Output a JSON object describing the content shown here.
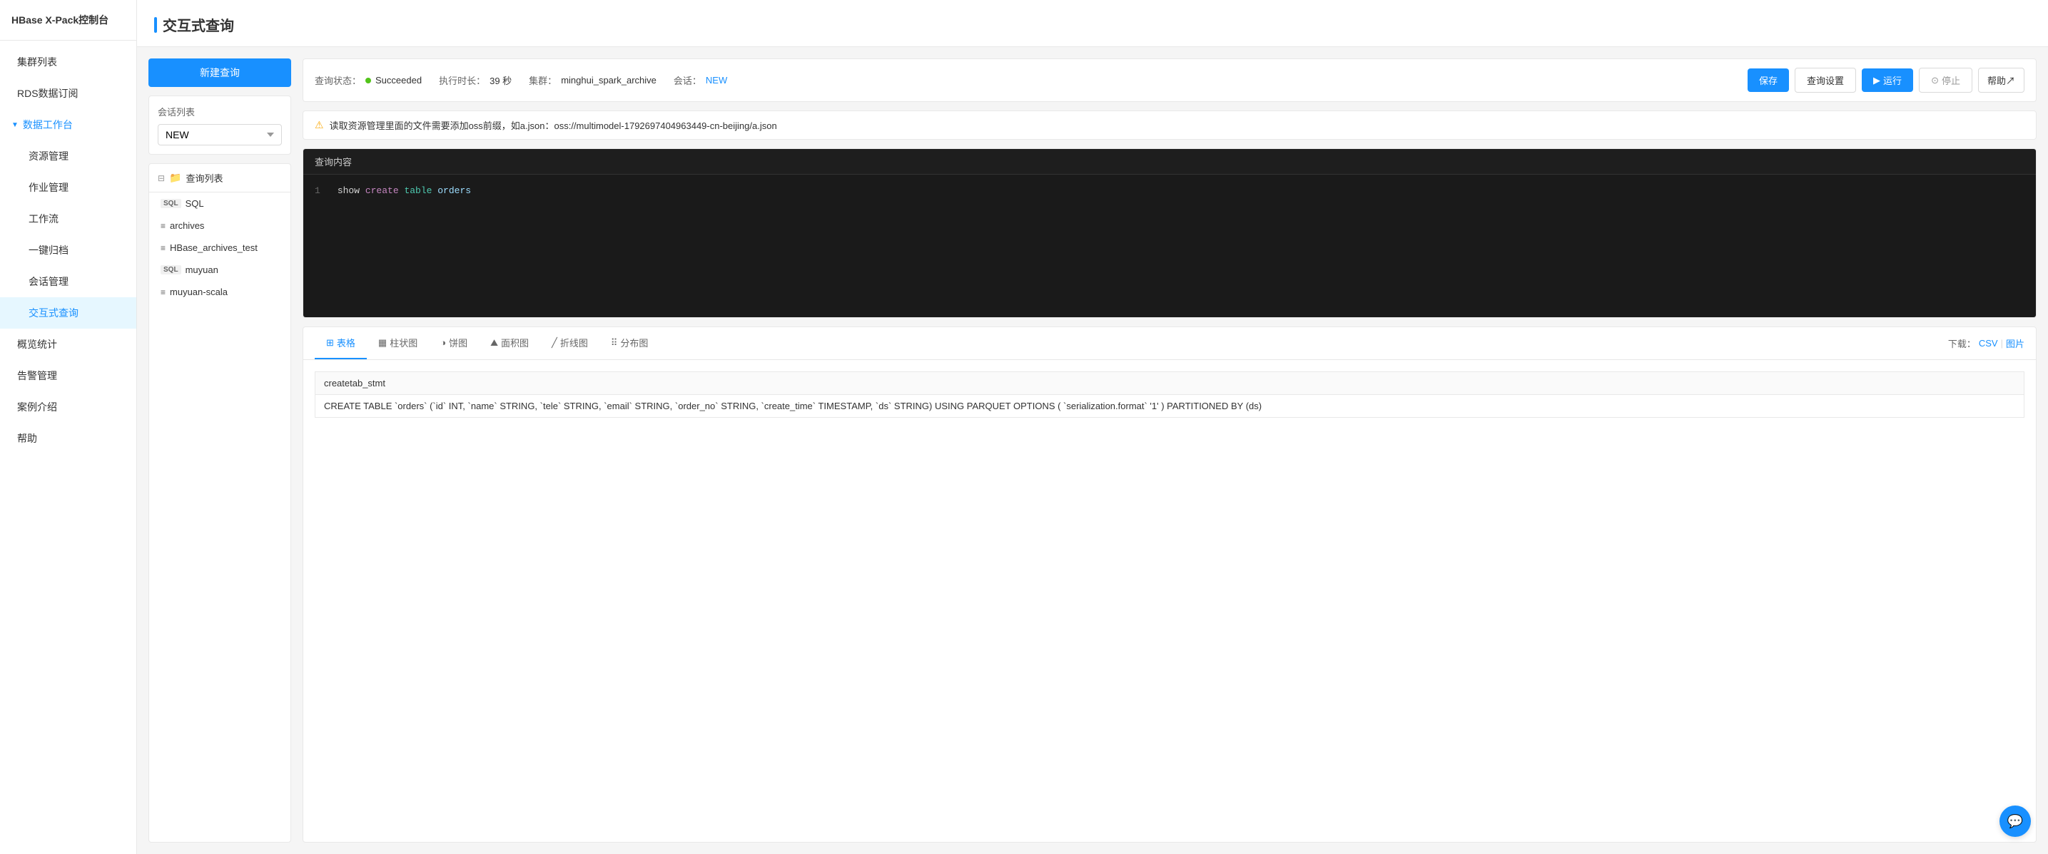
{
  "sidebar": {
    "logo": "HBase X-Pack控制台",
    "items": [
      {
        "id": "cluster-list",
        "label": "集群列表",
        "level": "top",
        "active": false
      },
      {
        "id": "rds-subscription",
        "label": "RDS数据订阅",
        "level": "top",
        "active": false
      },
      {
        "id": "data-workbench",
        "label": "数据工作台",
        "level": "group",
        "expanded": true
      },
      {
        "id": "resource-mgmt",
        "label": "资源管理",
        "level": "sub",
        "active": false
      },
      {
        "id": "job-mgmt",
        "label": "作业管理",
        "level": "sub",
        "active": false
      },
      {
        "id": "workflow",
        "label": "工作流",
        "level": "sub",
        "active": false
      },
      {
        "id": "one-key-archive",
        "label": "一键归档",
        "level": "sub",
        "active": false
      },
      {
        "id": "session-mgmt",
        "label": "会话管理",
        "level": "sub",
        "active": false
      },
      {
        "id": "interactive-query",
        "label": "交互式查询",
        "level": "sub",
        "active": true
      },
      {
        "id": "overview-stats",
        "label": "概览统计",
        "level": "top",
        "active": false
      },
      {
        "id": "alert-mgmt",
        "label": "告警管理",
        "level": "top",
        "active": false
      },
      {
        "id": "case-intro",
        "label": "案例介绍",
        "level": "top",
        "active": false
      },
      {
        "id": "help",
        "label": "帮助",
        "level": "top",
        "active": false
      }
    ]
  },
  "page": {
    "title": "交互式查询"
  },
  "toolbar": {
    "new_query_label": "新建查询",
    "session_list_label": "会话列表",
    "session_default": "NEW",
    "save_label": "保存",
    "settings_label": "查询设置",
    "run_label": "运行",
    "stop_label": "停止",
    "help_label": "帮助↗"
  },
  "query_status": {
    "label": "查询状态：",
    "status": "Succeeded",
    "duration_label": "执行时长：",
    "duration": "39 秒",
    "cluster_label": "集群：",
    "cluster": "minghui_spark_archive",
    "session_label": "会话：",
    "session": "NEW"
  },
  "warning": {
    "text": "读取资源管理里面的文件需要添加oss前缀，如a.json：oss://multimodel-1792697404963449-cn-beijing/a.json"
  },
  "editor": {
    "label": "查询内容",
    "line": "1",
    "code_parts": [
      {
        "text": "show ",
        "class": "kw-show"
      },
      {
        "text": "create",
        "class": "kw-create"
      },
      {
        "text": " table ",
        "class": "kw-table"
      },
      {
        "text": "orders",
        "class": "kw-ident"
      }
    ]
  },
  "query_list": {
    "title": "查询列表",
    "items": [
      {
        "id": "sql",
        "label": "SQL",
        "type": "sql",
        "active": false
      },
      {
        "id": "archives",
        "label": "archives",
        "type": "spark",
        "active": false
      },
      {
        "id": "hbase-archives-test",
        "label": "HBase_archives_test",
        "type": "spark",
        "active": false
      },
      {
        "id": "muyuan",
        "label": "muyuan",
        "type": "sql",
        "active": false
      },
      {
        "id": "muyuan-scala",
        "label": "muyuan-scala",
        "type": "spark",
        "active": false
      }
    ]
  },
  "results": {
    "tabs": [
      {
        "id": "table",
        "label": "表格",
        "icon": "⊞",
        "active": true
      },
      {
        "id": "bar",
        "label": "柱状图",
        "icon": "▦",
        "active": false
      },
      {
        "id": "pie",
        "label": "饼图",
        "icon": "◕",
        "active": false
      },
      {
        "id": "area",
        "label": "面积图",
        "icon": "▤",
        "active": false
      },
      {
        "id": "line",
        "label": "折线图",
        "icon": "╱",
        "active": false
      },
      {
        "id": "scatter",
        "label": "分布图",
        "icon": "⋮",
        "active": false
      }
    ],
    "download_label": "下载：",
    "download_csv": "CSV",
    "download_sep": "|",
    "download_img": "图片",
    "table": {
      "columns": [
        "createtab_stmt"
      ],
      "rows": [
        [
          "CREATE TABLE `orders` (`id` INT, `name` STRING, `tele` STRING, `email` STRING, `order_no` STRING, `create_time` TIMESTAMP, `ds` STRING) USING PARQUET OPTIONS ( `serialization.format` '1' ) PARTITIONED BY (ds)"
        ]
      ]
    }
  }
}
